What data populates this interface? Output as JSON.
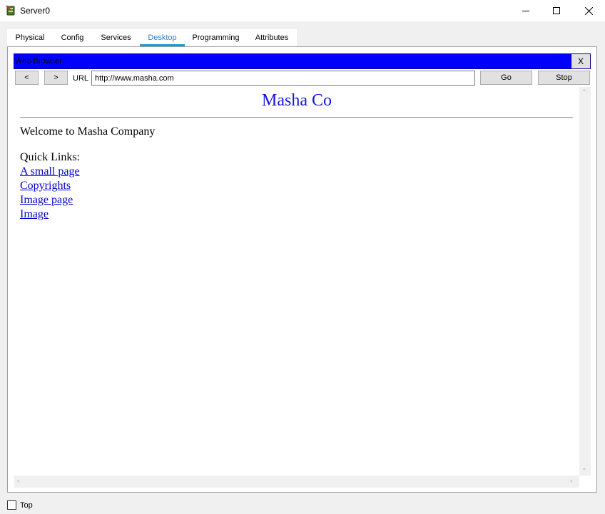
{
  "window": {
    "title": "Server0",
    "icon": "server-app-icon",
    "controls": [
      "minimize-icon",
      "maximize-icon",
      "close-icon"
    ]
  },
  "tabs": [
    {
      "label": "Physical",
      "active": false
    },
    {
      "label": "Config",
      "active": false
    },
    {
      "label": "Services",
      "active": false
    },
    {
      "label": "Desktop",
      "active": true
    },
    {
      "label": "Programming",
      "active": false
    },
    {
      "label": "Attributes",
      "active": false
    }
  ],
  "browser": {
    "title": "Web Browser",
    "close_label": "X",
    "back_label": "<",
    "forward_label": ">",
    "url_label": "URL",
    "url_value": "http://www.masha.com",
    "go_label": "Go",
    "stop_label": "Stop",
    "header_color": "#0000ff"
  },
  "page": {
    "heading": "Masha Co",
    "heading_color": "#1414e0",
    "welcome": "Welcome to Masha Company",
    "quick_links_label": "Quick Links:",
    "links": [
      "A small page",
      "Copyrights",
      "Image page",
      "Image"
    ],
    "link_color": "#0000cc"
  },
  "footer": {
    "top_label": "Top",
    "top_checked": false
  }
}
